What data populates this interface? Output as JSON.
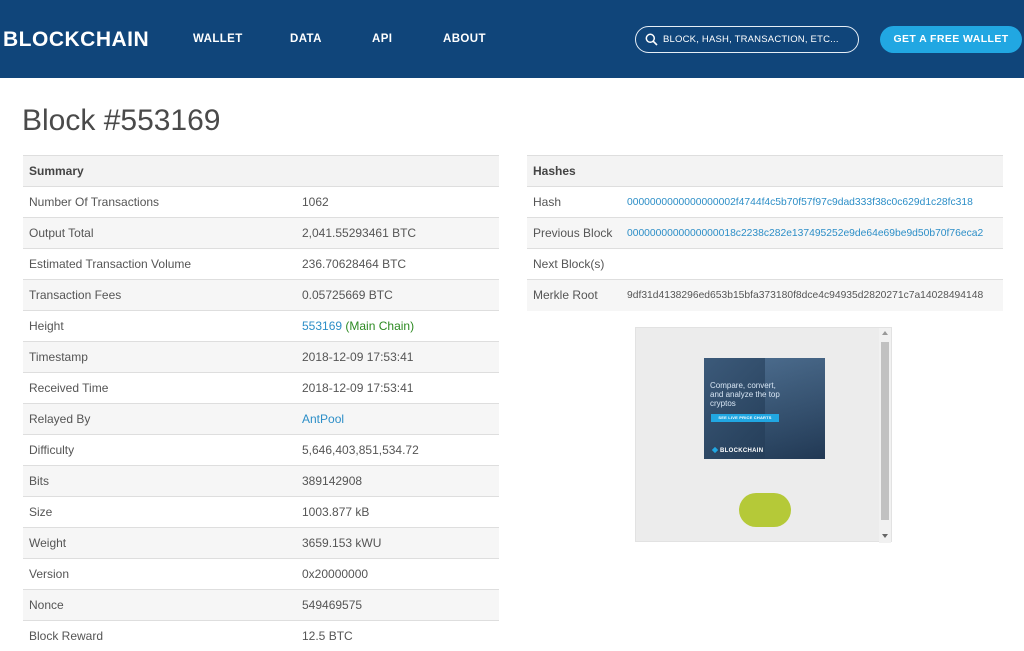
{
  "header": {
    "logo": "BLOCKCHAIN",
    "nav": [
      "WALLET",
      "DATA",
      "API",
      "ABOUT"
    ],
    "search_placeholder": "BLOCK, HASH, TRANSACTION, ETC...",
    "cta": "GET A FREE WALLET"
  },
  "title": "Block #553169",
  "summary": {
    "header": "Summary",
    "rows": [
      {
        "label": "Number Of Transactions",
        "value": "1062"
      },
      {
        "label": "Output Total",
        "value": "2,041.55293461 BTC"
      },
      {
        "label": "Estimated Transaction Volume",
        "value": "236.70628464 BTC"
      },
      {
        "label": "Transaction Fees",
        "value": "0.05725669 BTC"
      },
      {
        "label": "Height",
        "value": "553169",
        "suffix": "(Main Chain)"
      },
      {
        "label": "Timestamp",
        "value": "2018-12-09 17:53:41"
      },
      {
        "label": "Received Time",
        "value": "2018-12-09 17:53:41"
      },
      {
        "label": "Relayed By",
        "value": "AntPool"
      },
      {
        "label": "Difficulty",
        "value": "5,646,403,851,534.72"
      },
      {
        "label": "Bits",
        "value": "389142908"
      },
      {
        "label": "Size",
        "value": "1003.877 kB"
      },
      {
        "label": "Weight",
        "value": "3659.153 kWU"
      },
      {
        "label": "Version",
        "value": "0x20000000"
      },
      {
        "label": "Nonce",
        "value": "549469575"
      },
      {
        "label": "Block Reward",
        "value": "12.5 BTC"
      }
    ]
  },
  "hashes": {
    "header": "Hashes",
    "rows": [
      {
        "label": "Hash",
        "value": "0000000000000000002f4744f4c5b70f57f97c9dad333f38c0c629d1c28fc318"
      },
      {
        "label": "Previous Block",
        "value": "0000000000000000018c2238c282e137495252e9de64e69be9d50b70f76eca2"
      },
      {
        "label": "Next Block(s)",
        "value": ""
      },
      {
        "label": "Merkle Root",
        "value": "9df31d4138296ed653b15bfa373180f8dce4c94935d2820271c7a14028494148"
      }
    ]
  },
  "ad": {
    "text": "Compare, convert, and analyze the top cryptos",
    "button": "SEE LIVE PRICE CHARTS",
    "brand": "BLOCKCHAIN",
    "pill_color": "#b5c938"
  },
  "colors": {
    "header_bg": "#10457a",
    "accent": "#21a7e2",
    "link": "#2c8ec7",
    "main_chain": "#2d8a22"
  }
}
